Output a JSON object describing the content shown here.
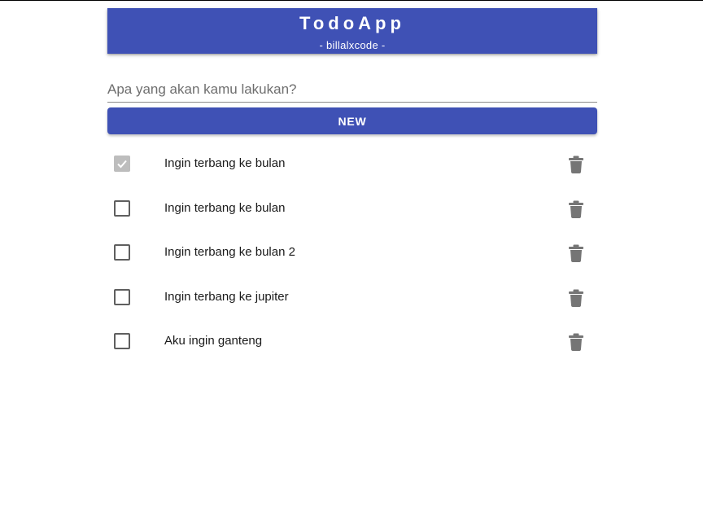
{
  "header": {
    "title": "TodoApp",
    "subtitle": "- billalxcode -"
  },
  "input": {
    "placeholder": "Apa yang akan kamu lakukan?",
    "value": ""
  },
  "new_button": {
    "label": "NEW"
  },
  "colors": {
    "primary": "#3f51b5",
    "checked_disabled": "#bdbdbd",
    "icon": "#757575"
  },
  "icons": {
    "checkbox": "checkbox-icon",
    "checked": "check-icon",
    "delete": "trash-icon"
  },
  "todos": [
    {
      "text": "Ingin terbang ke bulan",
      "done": true
    },
    {
      "text": "Ingin terbang ke bulan",
      "done": false
    },
    {
      "text": "Ingin terbang ke bulan 2",
      "done": false
    },
    {
      "text": "Ingin terbang ke jupiter",
      "done": false
    },
    {
      "text": "Aku ingin ganteng",
      "done": false
    }
  ]
}
